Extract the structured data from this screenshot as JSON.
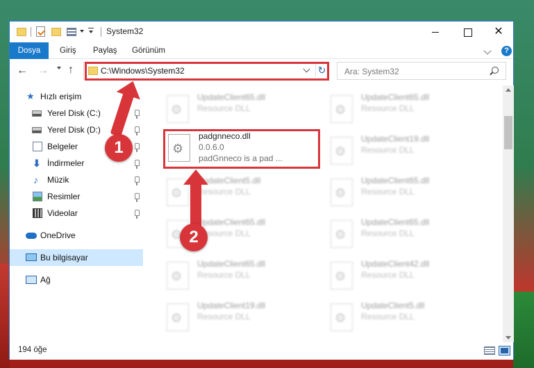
{
  "window": {
    "title": "System32",
    "close_glyph": "✕"
  },
  "ribbon": {
    "tabs": [
      {
        "label": "Dosya"
      },
      {
        "label": "Giriş"
      },
      {
        "label": "Paylaş"
      },
      {
        "label": "Görünüm"
      }
    ],
    "help_glyph": "?"
  },
  "nav": {
    "back_glyph": "←",
    "forward_glyph": "→",
    "up_glyph": "↑"
  },
  "address": {
    "path": "C:\\Windows\\System32",
    "refresh_glyph": "↻"
  },
  "search": {
    "placeholder": "Ara: System32"
  },
  "sidebar": {
    "items": [
      {
        "label": "Hızlı erişim",
        "icon": "star-icon"
      },
      {
        "label": "Yerel Disk (C:)",
        "icon": "drive-icon"
      },
      {
        "label": "Yerel Disk (D:)",
        "icon": "drive-icon"
      },
      {
        "label": "Belgeler",
        "icon": "documents-icon"
      },
      {
        "label": "İndirmeler",
        "icon": "downloads-icon"
      },
      {
        "label": "Müzik",
        "icon": "music-icon"
      },
      {
        "label": "Resimler",
        "icon": "pictures-icon"
      },
      {
        "label": "Videolar",
        "icon": "videos-icon"
      },
      {
        "label": "OneDrive",
        "icon": "cloud-icon"
      },
      {
        "label": "Bu bilgisayar",
        "icon": "computer-icon"
      },
      {
        "label": "Ağ",
        "icon": "network-icon"
      }
    ],
    "star_glyph": "★",
    "download_glyph": "⬇",
    "music_glyph": "♪"
  },
  "files": {
    "highlighted": {
      "name": "padgnneco.dll",
      "version": "0.0.6.0",
      "description": "padGnneco is a pad ..."
    },
    "background": [
      {
        "name": "UpdateClient65.dll",
        "desc": "Resource DLL"
      },
      {
        "name": "UpdateClient65.dll",
        "desc": "Resource DLL"
      },
      {
        "name": "UpdateClient19.dll",
        "desc": "Resource DLL"
      },
      {
        "name": "UpdateClient5.dll",
        "desc": "Resource DLL"
      },
      {
        "name": "UpdateClient65.dll",
        "desc": "Resource DLL"
      },
      {
        "name": "UpdateClient65.dll",
        "desc": "Resource DLL"
      },
      {
        "name": "UpdateClient65.dll",
        "desc": "Resource DLL"
      },
      {
        "name": "UpdateClient65.dll",
        "desc": "Resource DLL"
      },
      {
        "name": "UpdateClient42.dll",
        "desc": "Resource DLL"
      },
      {
        "name": "UpdateClient19.dll",
        "desc": "Resource DLL"
      },
      {
        "name": "UpdateClient5.dll",
        "desc": "Resource DLL"
      }
    ]
  },
  "status": {
    "count": "194 öğe"
  },
  "annotations": {
    "step1": "1",
    "step2": "2",
    "color": "#d8353a"
  },
  "colors": {
    "accent": "#1979ca",
    "selection": "#cde8ff"
  }
}
